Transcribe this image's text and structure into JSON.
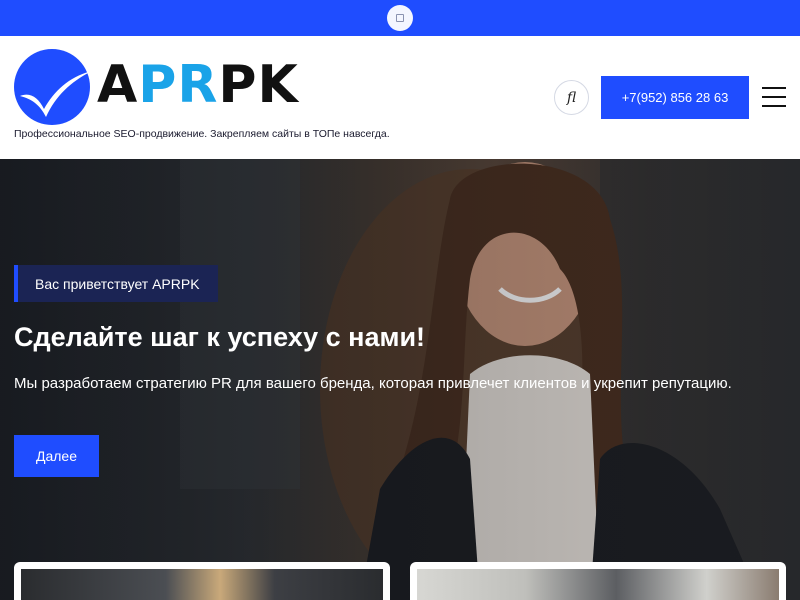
{
  "header": {
    "logo": {
      "part1": "A",
      "part2": "PR",
      "part3": "PK"
    },
    "tagline": "Профессиональное SEO-продвижение. Закрепляем сайты в ТОПе навсегда.",
    "social_icon": "facebook-icon",
    "social_glyph": "fl",
    "phone": "+7(952) 856 28 63",
    "menu_icon": "hamburger-icon"
  },
  "hero": {
    "badge": "Вас приветствует APRPK",
    "title": "Сделайте шаг к успеху с нами!",
    "subtitle": "Мы разработаем стратегию PR для вашего бренда, которая привлечет клиентов и укрепит репутацию.",
    "button": "Далее"
  },
  "colors": {
    "brand_blue": "#1f4dff",
    "logo_accent": "#1aa3e8",
    "badge_bg": "#1b2454"
  }
}
